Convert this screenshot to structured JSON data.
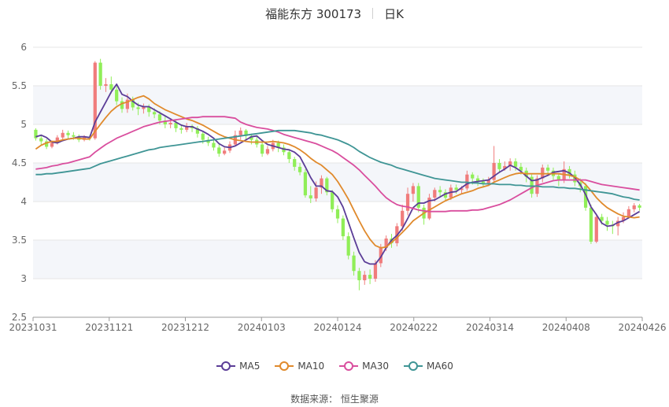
{
  "header": {
    "title": "福能东方 300173",
    "period": "日K"
  },
  "source": {
    "label": "数据来源：",
    "name": "恒生聚源"
  },
  "chart_data": {
    "type": "candlestick",
    "ylim": [
      2.5,
      6
    ],
    "yticks": [
      "2.5",
      "3",
      "3.5",
      "4",
      "4.5",
      "5",
      "5.5",
      "6"
    ],
    "xticks": [
      "20231031",
      "20231121",
      "20231212",
      "20240103",
      "20240124",
      "20240222",
      "20240314",
      "20240408",
      "20240426"
    ],
    "colors": {
      "up": "#f07c7c",
      "down": "#90ee58"
    },
    "candles": [
      [
        4.93,
        4.82,
        4.95,
        4.79
      ],
      [
        4.82,
        4.78,
        4.86,
        4.74
      ],
      [
        4.78,
        4.71,
        4.81,
        4.68
      ],
      [
        4.71,
        4.76,
        4.79,
        4.69
      ],
      [
        4.76,
        4.83,
        4.86,
        4.74
      ],
      [
        4.83,
        4.89,
        4.93,
        4.8
      ],
      [
        4.89,
        4.86,
        4.92,
        4.81
      ],
      [
        4.86,
        4.84,
        4.9,
        4.8
      ],
      [
        4.84,
        4.8,
        4.87,
        4.77
      ],
      [
        4.8,
        4.83,
        4.86,
        4.78
      ],
      [
        4.83,
        4.82,
        4.86,
        4.79
      ],
      [
        4.82,
        5.8,
        5.82,
        4.8
      ],
      [
        5.8,
        5.5,
        5.85,
        5.45
      ],
      [
        5.5,
        5.52,
        5.6,
        5.42
      ],
      [
        5.52,
        5.45,
        5.62,
        5.4
      ],
      [
        5.45,
        5.3,
        5.5,
        5.25
      ],
      [
        5.3,
        5.2,
        5.35,
        5.15
      ],
      [
        5.2,
        5.32,
        5.4,
        5.15
      ],
      [
        5.32,
        5.22,
        5.36,
        5.18
      ],
      [
        5.22,
        5.2,
        5.28,
        5.12
      ],
      [
        5.2,
        5.23,
        5.27,
        5.14
      ],
      [
        5.23,
        5.16,
        5.26,
        5.1
      ],
      [
        5.16,
        5.13,
        5.21,
        5.08
      ],
      [
        5.13,
        5.05,
        5.17,
        5.0
      ],
      [
        5.05,
        5.0,
        5.1,
        4.95
      ],
      [
        5.0,
        5.02,
        5.06,
        4.95
      ],
      [
        5.02,
        4.95,
        5.05,
        4.9
      ],
      [
        4.95,
        4.93,
        5.0,
        4.88
      ],
      [
        4.93,
        4.98,
        5.02,
        4.9
      ],
      [
        4.98,
        4.95,
        5.0,
        4.9
      ],
      [
        4.95,
        4.88,
        4.98,
        4.83
      ],
      [
        4.88,
        4.8,
        4.91,
        4.75
      ],
      [
        4.8,
        4.76,
        4.84,
        4.72
      ],
      [
        4.76,
        4.7,
        4.8,
        4.66
      ],
      [
        4.7,
        4.62,
        4.74,
        4.58
      ],
      [
        4.62,
        4.66,
        4.7,
        4.6
      ],
      [
        4.66,
        4.74,
        4.78,
        4.63
      ],
      [
        4.74,
        4.86,
        4.92,
        4.72
      ],
      [
        4.86,
        4.92,
        4.96,
        4.8
      ],
      [
        4.92,
        4.85,
        4.94,
        4.8
      ],
      [
        4.85,
        4.8,
        4.88,
        4.74
      ],
      [
        4.8,
        4.74,
        4.84,
        4.7
      ],
      [
        4.74,
        4.62,
        4.77,
        4.58
      ],
      [
        4.62,
        4.68,
        4.72,
        4.6
      ],
      [
        4.68,
        4.76,
        4.8,
        4.65
      ],
      [
        4.76,
        4.7,
        4.79,
        4.64
      ],
      [
        4.7,
        4.64,
        4.74,
        4.6
      ],
      [
        4.64,
        4.55,
        4.68,
        4.5
      ],
      [
        4.55,
        4.45,
        4.58,
        4.4
      ],
      [
        4.45,
        4.38,
        4.5,
        4.34
      ],
      [
        4.38,
        4.08,
        4.42,
        4.05
      ],
      [
        4.08,
        4.04,
        4.2,
        3.98
      ],
      [
        4.04,
        4.18,
        4.26,
        4.0
      ],
      [
        4.18,
        4.3,
        4.34,
        4.1
      ],
      [
        4.3,
        4.12,
        4.32,
        4.08
      ],
      [
        4.12,
        3.9,
        4.15,
        3.86
      ],
      [
        3.9,
        3.78,
        3.95,
        3.72
      ],
      [
        3.78,
        3.55,
        3.82,
        3.5
      ],
      [
        3.55,
        3.3,
        3.6,
        3.25
      ],
      [
        3.3,
        3.1,
        3.35,
        3.04
      ],
      [
        3.1,
        2.98,
        3.14,
        2.85
      ],
      [
        2.98,
        3.05,
        3.1,
        2.92
      ],
      [
        3.05,
        3.0,
        3.12,
        2.93
      ],
      [
        3.0,
        3.2,
        3.24,
        2.96
      ],
      [
        3.2,
        3.4,
        3.45,
        3.15
      ],
      [
        3.4,
        3.52,
        3.56,
        3.36
      ],
      [
        3.52,
        3.46,
        3.58,
        3.4
      ],
      [
        3.46,
        3.68,
        3.72,
        3.42
      ],
      [
        3.68,
        3.88,
        3.96,
        3.62
      ],
      [
        3.88,
        4.1,
        4.18,
        3.82
      ],
      [
        4.1,
        4.2,
        4.24,
        4.0
      ],
      [
        4.2,
        3.92,
        4.24,
        3.86
      ],
      [
        3.92,
        3.78,
        3.96,
        3.7
      ],
      [
        3.78,
        4.05,
        4.1,
        3.76
      ],
      [
        4.05,
        4.15,
        4.18,
        4.0
      ],
      [
        4.15,
        4.12,
        4.2,
        4.05
      ],
      [
        4.12,
        4.05,
        4.16,
        4.0
      ],
      [
        4.05,
        4.18,
        4.22,
        4.02
      ],
      [
        4.18,
        4.15,
        4.22,
        4.1
      ],
      [
        4.15,
        4.17,
        4.2,
        4.1
      ],
      [
        4.17,
        4.35,
        4.4,
        4.14
      ],
      [
        4.35,
        4.3,
        4.38,
        4.22
      ],
      [
        4.3,
        4.26,
        4.34,
        4.2
      ],
      [
        4.26,
        4.24,
        4.3,
        4.18
      ],
      [
        4.24,
        4.28,
        4.32,
        4.2
      ],
      [
        4.28,
        4.5,
        4.72,
        4.25
      ],
      [
        4.5,
        4.42,
        4.55,
        4.38
      ],
      [
        4.42,
        4.46,
        4.52,
        4.4
      ],
      [
        4.46,
        4.52,
        4.56,
        4.4
      ],
      [
        4.52,
        4.45,
        4.56,
        4.4
      ],
      [
        4.45,
        4.4,
        4.5,
        4.35
      ],
      [
        4.4,
        4.32,
        4.44,
        4.25
      ],
      [
        4.32,
        4.1,
        4.35,
        4.05
      ],
      [
        4.1,
        4.3,
        4.34,
        4.06
      ],
      [
        4.3,
        4.44,
        4.48,
        4.25
      ],
      [
        4.44,
        4.4,
        4.48,
        4.35
      ],
      [
        4.4,
        4.33,
        4.44,
        4.28
      ],
      [
        4.33,
        4.28,
        4.36,
        4.2
      ],
      [
        4.28,
        4.42,
        4.52,
        4.24
      ],
      [
        4.42,
        4.35,
        4.46,
        4.3
      ],
      [
        4.35,
        4.25,
        4.4,
        4.2
      ],
      [
        4.25,
        4.2,
        4.3,
        4.12
      ],
      [
        4.2,
        3.92,
        4.24,
        3.88
      ],
      [
        3.92,
        3.48,
        3.96,
        3.45
      ],
      [
        3.48,
        3.8,
        3.84,
        3.46
      ],
      [
        3.8,
        3.75,
        3.84,
        3.7
      ],
      [
        3.75,
        3.7,
        3.8,
        3.62
      ],
      [
        3.7,
        3.68,
        3.75,
        3.58
      ],
      [
        3.68,
        3.75,
        3.8,
        3.56
      ],
      [
        3.75,
        3.8,
        3.86,
        3.72
      ],
      [
        3.8,
        3.9,
        3.94,
        3.78
      ],
      [
        3.9,
        3.95,
        3.98,
        3.86
      ],
      [
        3.95,
        3.92,
        3.97,
        3.88
      ]
    ],
    "series": [
      {
        "name": "MA5",
        "color": "#5b3d97",
        "values": [
          4.84,
          4.86,
          4.83,
          4.77,
          4.76,
          4.79,
          4.81,
          4.82,
          4.84,
          4.84,
          4.83,
          5.03,
          5.16,
          5.29,
          5.42,
          5.52,
          5.39,
          5.36,
          5.3,
          5.25,
          5.23,
          5.23,
          5.19,
          5.15,
          5.11,
          5.07,
          5.03,
          4.99,
          4.97,
          4.97,
          4.94,
          4.91,
          4.87,
          4.82,
          4.75,
          4.71,
          4.7,
          4.72,
          4.76,
          4.8,
          4.84,
          4.85,
          4.79,
          4.74,
          4.72,
          4.7,
          4.68,
          4.67,
          4.64,
          4.58,
          4.45,
          4.31,
          4.2,
          4.2,
          4.14,
          4.13,
          4.06,
          3.93,
          3.73,
          3.53,
          3.34,
          3.22,
          3.19,
          3.19,
          3.28,
          3.4,
          3.5,
          3.56,
          3.65,
          3.78,
          3.92,
          3.98,
          3.98,
          4.01,
          4.02,
          4.06,
          4.1,
          4.12,
          4.13,
          4.18,
          4.23,
          4.25,
          4.26,
          4.27,
          4.28,
          4.33,
          4.38,
          4.42,
          4.47,
          4.44,
          4.39,
          4.33,
          4.27,
          4.28,
          4.31,
          4.34,
          4.38,
          4.39,
          4.4,
          4.37,
          4.31,
          4.22,
          4.09,
          3.93,
          3.83,
          3.72,
          3.68,
          3.69,
          3.73,
          3.75,
          3.79,
          3.83,
          3.87
        ]
      },
      {
        "name": "MA10",
        "color": "#e08a2c",
        "values": [
          4.68,
          4.73,
          4.76,
          4.78,
          4.78,
          4.8,
          4.81,
          4.82,
          4.82,
          4.81,
          4.81,
          4.91,
          5.0,
          5.09,
          5.17,
          5.23,
          5.27,
          5.29,
          5.32,
          5.35,
          5.37,
          5.33,
          5.27,
          5.23,
          5.19,
          5.16,
          5.13,
          5.1,
          5.07,
          5.05,
          5.02,
          4.99,
          4.95,
          4.91,
          4.87,
          4.84,
          4.82,
          4.8,
          4.79,
          4.78,
          4.77,
          4.77,
          4.77,
          4.77,
          4.78,
          4.77,
          4.76,
          4.74,
          4.71,
          4.67,
          4.62,
          4.56,
          4.51,
          4.47,
          4.41,
          4.35,
          4.26,
          4.15,
          4.03,
          3.89,
          3.75,
          3.62,
          3.51,
          3.43,
          3.4,
          3.41,
          3.47,
          3.53,
          3.6,
          3.67,
          3.75,
          3.8,
          3.85,
          3.89,
          3.93,
          3.97,
          4.01,
          4.04,
          4.07,
          4.1,
          4.12,
          4.14,
          4.17,
          4.19,
          4.21,
          4.25,
          4.28,
          4.31,
          4.34,
          4.36,
          4.37,
          4.36,
          4.36,
          4.36,
          4.36,
          4.36,
          4.36,
          4.36,
          4.35,
          4.34,
          4.32,
          4.28,
          4.22,
          4.14,
          4.05,
          3.98,
          3.92,
          3.88,
          3.84,
          3.81,
          3.8,
          3.79,
          3.8
        ]
      },
      {
        "name": "MA30",
        "color": "#d94e9e",
        "values": [
          4.42,
          4.43,
          4.44,
          4.46,
          4.47,
          4.49,
          4.5,
          4.52,
          4.54,
          4.56,
          4.58,
          4.64,
          4.69,
          4.74,
          4.78,
          4.82,
          4.85,
          4.88,
          4.91,
          4.94,
          4.97,
          4.99,
          5.01,
          5.03,
          5.04,
          5.05,
          5.06,
          5.07,
          5.08,
          5.09,
          5.09,
          5.1,
          5.1,
          5.1,
          5.1,
          5.1,
          5.09,
          5.08,
          5.03,
          5.0,
          4.98,
          4.96,
          4.95,
          4.94,
          4.92,
          4.9,
          4.87,
          4.85,
          4.83,
          4.81,
          4.79,
          4.77,
          4.75,
          4.72,
          4.69,
          4.66,
          4.62,
          4.57,
          4.52,
          4.47,
          4.41,
          4.34,
          4.27,
          4.2,
          4.12,
          4.05,
          4.0,
          3.96,
          3.94,
          3.93,
          3.91,
          3.89,
          3.88,
          3.87,
          3.87,
          3.87,
          3.87,
          3.88,
          3.88,
          3.88,
          3.88,
          3.89,
          3.89,
          3.9,
          3.92,
          3.94,
          3.96,
          3.99,
          4.02,
          4.06,
          4.1,
          4.14,
          4.18,
          4.21,
          4.23,
          4.25,
          4.27,
          4.28,
          4.28,
          4.28,
          4.28,
          4.28,
          4.28,
          4.26,
          4.24,
          4.22,
          4.21,
          4.2,
          4.19,
          4.18,
          4.17,
          4.16,
          4.15
        ]
      },
      {
        "name": "MA60",
        "color": "#3f9595",
        "values": [
          4.35,
          4.35,
          4.36,
          4.36,
          4.37,
          4.38,
          4.39,
          4.4,
          4.41,
          4.42,
          4.43,
          4.46,
          4.49,
          4.51,
          4.53,
          4.55,
          4.57,
          4.59,
          4.61,
          4.63,
          4.65,
          4.67,
          4.68,
          4.7,
          4.71,
          4.72,
          4.73,
          4.74,
          4.75,
          4.76,
          4.77,
          4.78,
          4.79,
          4.8,
          4.81,
          4.82,
          4.83,
          4.84,
          4.85,
          4.86,
          4.87,
          4.88,
          4.89,
          4.9,
          4.91,
          4.92,
          4.92,
          4.92,
          4.92,
          4.91,
          4.9,
          4.89,
          4.87,
          4.86,
          4.84,
          4.82,
          4.8,
          4.77,
          4.74,
          4.7,
          4.65,
          4.61,
          4.57,
          4.54,
          4.51,
          4.49,
          4.47,
          4.44,
          4.42,
          4.4,
          4.38,
          4.36,
          4.34,
          4.32,
          4.3,
          4.29,
          4.28,
          4.27,
          4.26,
          4.25,
          4.25,
          4.24,
          4.24,
          4.23,
          4.23,
          4.23,
          4.22,
          4.22,
          4.22,
          4.21,
          4.21,
          4.2,
          4.2,
          4.2,
          4.19,
          4.19,
          4.19,
          4.18,
          4.18,
          4.17,
          4.17,
          4.16,
          4.15,
          4.14,
          4.13,
          4.12,
          4.11,
          4.1,
          4.08,
          4.06,
          4.05,
          4.03,
          4.02
        ]
      }
    ]
  }
}
